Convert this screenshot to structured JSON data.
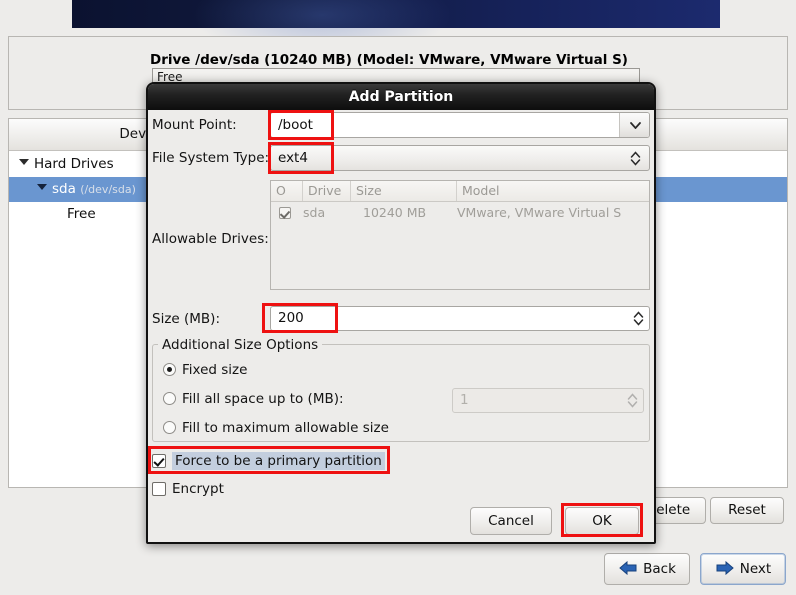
{
  "background": {
    "drive_title": "Drive /dev/sda (10240 MB) (Model: VMware, VMware Virtual S)",
    "drive_bar_segment": "Free",
    "tree": {
      "header": "Device",
      "rows": [
        {
          "label": "Hard Drives",
          "sub": ""
        },
        {
          "label": "sda",
          "sub": "(/dev/sda)"
        },
        {
          "label": "Free",
          "sub": ""
        }
      ]
    },
    "buttons": {
      "delete": "Delete",
      "reset": "Reset",
      "back": "Back",
      "next": "Next"
    }
  },
  "dialog": {
    "title": "Add Partition",
    "labels": {
      "mount_point": "Mount Point:",
      "file_system_type": "File System Type:",
      "allowable_drives": "Allowable Drives:",
      "size_mb": "Size (MB):"
    },
    "mount_point_value": "/boot",
    "file_system_type_value": "ext4",
    "allowable_drives": {
      "columns": [
        "O",
        "Drive",
        "Size",
        "Model"
      ],
      "rows": [
        {
          "checked": "✓",
          "drive": "sda",
          "size": "10240 MB",
          "model": "VMware, VMware Virtual S"
        }
      ]
    },
    "size_value": "200",
    "size_options": {
      "group_label": "Additional Size Options",
      "fixed_size": "Fixed size",
      "fill_all_space": "Fill all space up to (MB):",
      "fill_all_space_value": "1",
      "fill_maximum": "Fill to maximum allowable size"
    },
    "force_primary": "Force to be a primary partition",
    "encrypt": "Encrypt",
    "buttons": {
      "cancel": "Cancel",
      "ok": "OK"
    }
  },
  "colors": {
    "selection_blue": "#6a96d0",
    "annotation_red": "#ee1111",
    "titlebar_dark": "#0d0d0d",
    "banner_blue": "#16225a",
    "focus_label_bg": "#c3cede"
  }
}
